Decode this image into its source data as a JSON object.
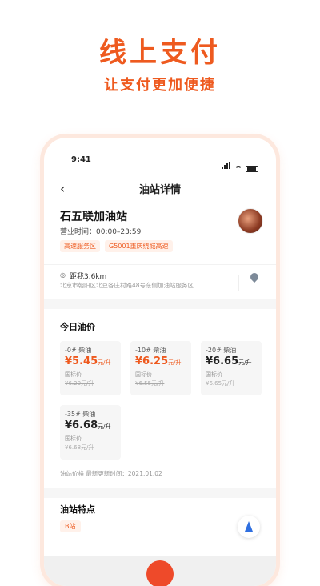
{
  "hero": {
    "title": "线上支付",
    "subtitle": "让支付更加便捷"
  },
  "status_bar": {
    "time": "9:41"
  },
  "nav": {
    "back_icon": "chevron-left-icon",
    "title": "油站详情"
  },
  "station": {
    "name": "石五联加油站",
    "hours": "营业时间：00:00–23:59",
    "tags": [
      "高速服务区",
      "G5001重庆绕城高速"
    ],
    "distance": "距我3.6km",
    "address": "北京市朝阳区北豆各庄村路48号东侧加油站服务区"
  },
  "prices": {
    "title": "今日油价",
    "unit": "元/升",
    "ref_label": "国标价",
    "items": [
      {
        "grade": "-0# 柴油",
        "price": "¥5.45",
        "ref": "¥6.20元/升",
        "discounted": true
      },
      {
        "grade": "-10# 柴油",
        "price": "¥6.25",
        "ref": "¥6.55元/升",
        "discounted": true
      },
      {
        "grade": "-20# 柴油",
        "price": "¥6.65",
        "ref": "¥6.65元/升",
        "discounted": false
      },
      {
        "grade": "-35# 柴油",
        "price": "¥6.68",
        "ref": "¥6.68元/升",
        "discounted": false
      }
    ],
    "update_text": "油站价格 最新更新时间：2021.01.02"
  },
  "features": {
    "title": "油站特点",
    "tag": "B站"
  },
  "colors": {
    "accent": "#ee5a1f",
    "navigate": "#2f6fe0"
  }
}
